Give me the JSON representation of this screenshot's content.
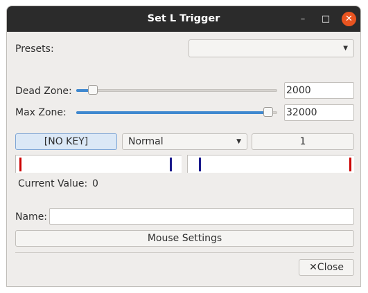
{
  "window": {
    "title": "Set L Trigger",
    "controls": {
      "minimize": "–",
      "maximize": "□",
      "close": "✕"
    }
  },
  "presets": {
    "label": "Presets:",
    "value": ""
  },
  "dead_zone": {
    "label": "Dead Zone:",
    "value": "2000",
    "level": 0.06
  },
  "max_zone": {
    "label": "Max Zone:",
    "value": "32000",
    "level": 0.98
  },
  "key_button": {
    "label": "[NO KEY]"
  },
  "mode_select": {
    "value": "Normal"
  },
  "multiplier_button": {
    "label": "1"
  },
  "current_value": {
    "label": "Current Value:",
    "value": "0"
  },
  "name": {
    "label": "Name:",
    "value": ""
  },
  "mouse_settings": {
    "label": "Mouse Settings"
  },
  "close_button": {
    "icon": "✕",
    "label": "Close"
  },
  "colors": {
    "accent": "#3f88cf",
    "marker_red": "#cc0000",
    "marker_blue": "#1a1a8c",
    "titlebar": "#2b2b2b",
    "close_circle": "#e95420"
  }
}
